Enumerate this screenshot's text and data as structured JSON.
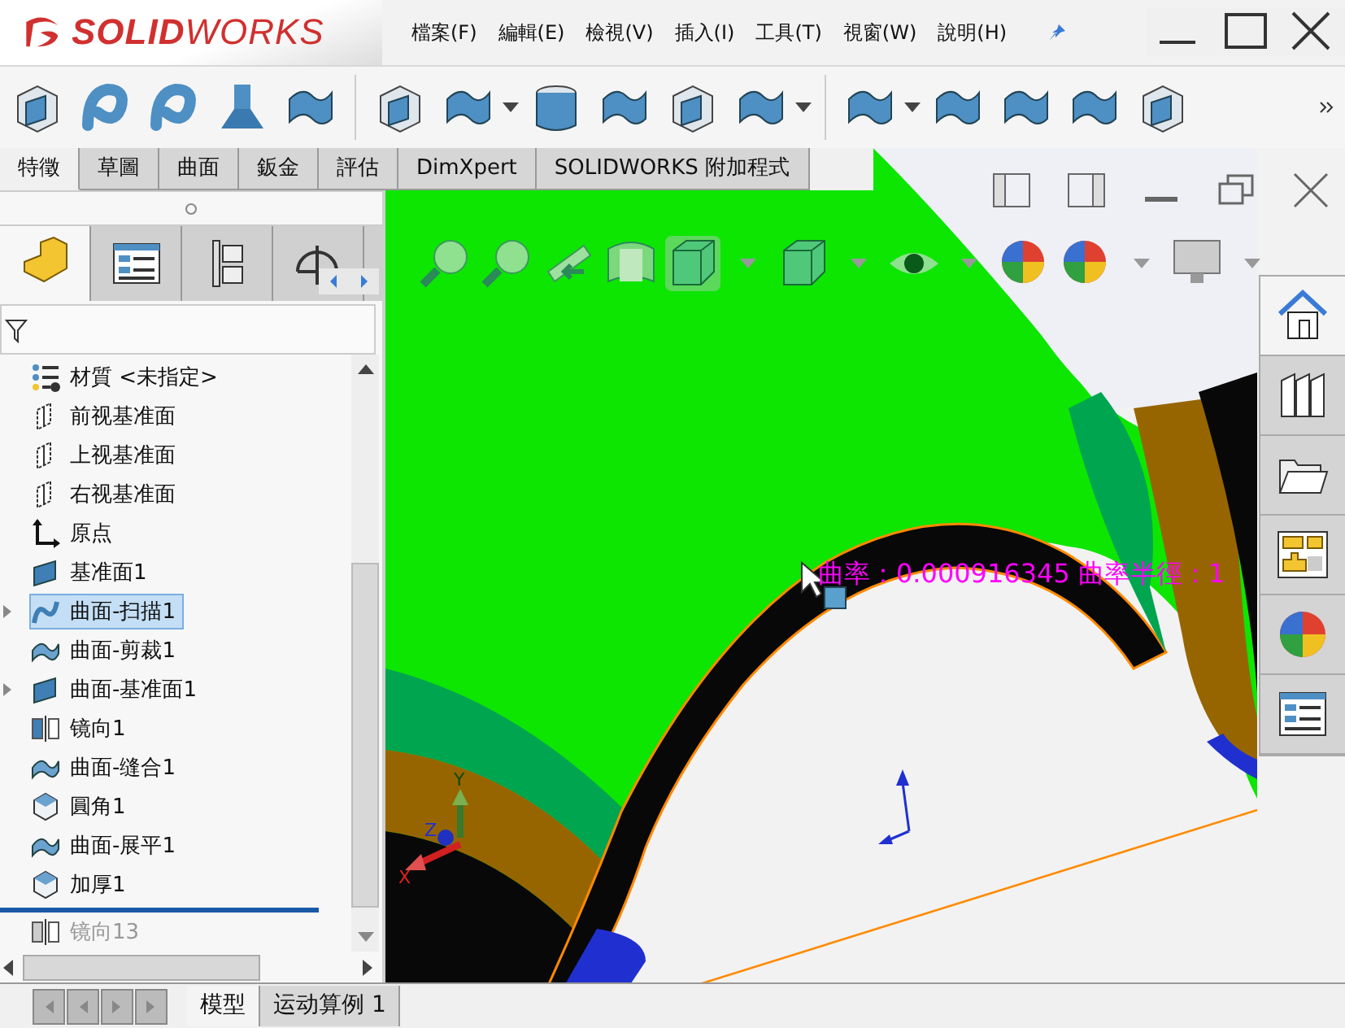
{
  "window": {
    "logo": "**SOLID**WORKS"
  },
  "menu": [
    "檔案(F)",
    "編輯(E)",
    "檢視(V)",
    "插入(I)",
    "工具(T)",
    "視窗(W)",
    "說明(H)"
  ],
  "tabs": [
    {
      "label": "特徵",
      "selected": true
    },
    {
      "label": "草圖",
      "selected": false
    },
    {
      "label": "曲面",
      "selected": false
    },
    {
      "label": "鈑金",
      "selected": false
    },
    {
      "label": "評估",
      "selected": false
    },
    {
      "label": "DimXpert",
      "selected": false
    },
    {
      "label": "SOLIDWORKS 附加程式",
      "selected": false
    }
  ],
  "panel_tabs": [
    {
      "kind": "feature",
      "selected": true
    },
    {
      "kind": "property",
      "selected": false
    },
    {
      "kind": "config",
      "selected": false
    },
    {
      "kind": "dim",
      "selected": false
    }
  ],
  "tree": [
    {
      "label": "材質 <未指定>",
      "kind": "material",
      "expandable": false,
      "selected": false,
      "disabled": false
    },
    {
      "label": "前视基准面",
      "kind": "plane",
      "expandable": false,
      "selected": false,
      "disabled": false
    },
    {
      "label": "上视基准面",
      "kind": "plane",
      "expandable": false,
      "selected": false,
      "disabled": false
    },
    {
      "label": "右视基准面",
      "kind": "plane",
      "expandable": false,
      "selected": false,
      "disabled": false
    },
    {
      "label": "原点",
      "kind": "origin",
      "expandable": false,
      "selected": false,
      "disabled": false
    },
    {
      "label": "基准面1",
      "kind": "refplane",
      "expandable": false,
      "selected": false,
      "disabled": false
    },
    {
      "label": "曲面-扫描1",
      "kind": "sweep",
      "expandable": true,
      "selected": true,
      "disabled": false
    },
    {
      "label": "曲面-剪裁1",
      "kind": "surface",
      "expandable": false,
      "selected": false,
      "disabled": false
    },
    {
      "label": "曲面-基准面1",
      "kind": "refplane",
      "expandable": true,
      "selected": false,
      "disabled": false
    },
    {
      "label": "镜向1",
      "kind": "mirror",
      "expandable": false,
      "selected": false,
      "disabled": false
    },
    {
      "label": "曲面-缝合1",
      "kind": "surface",
      "expandable": false,
      "selected": false,
      "disabled": false
    },
    {
      "label": "圓角1",
      "kind": "cube",
      "expandable": false,
      "selected": false,
      "disabled": false
    },
    {
      "label": "曲面-展平1",
      "kind": "surface",
      "expandable": false,
      "selected": false,
      "disabled": false
    },
    {
      "label": "加厚1",
      "kind": "cube",
      "expandable": false,
      "selected": false,
      "disabled": false
    },
    {
      "label": "镜向13",
      "kind": "mirror",
      "expandable": false,
      "selected": false,
      "disabled": true
    }
  ],
  "viewport": {
    "curvature_readout": "曲率：0.000916345  曲率半徑：1",
    "triad": {
      "x": "X",
      "y": "Y",
      "z": "Z"
    }
  },
  "bottom_tabs": [
    {
      "label": "模型",
      "selected": true
    },
    {
      "label": "运动算例 1",
      "selected": false
    }
  ]
}
